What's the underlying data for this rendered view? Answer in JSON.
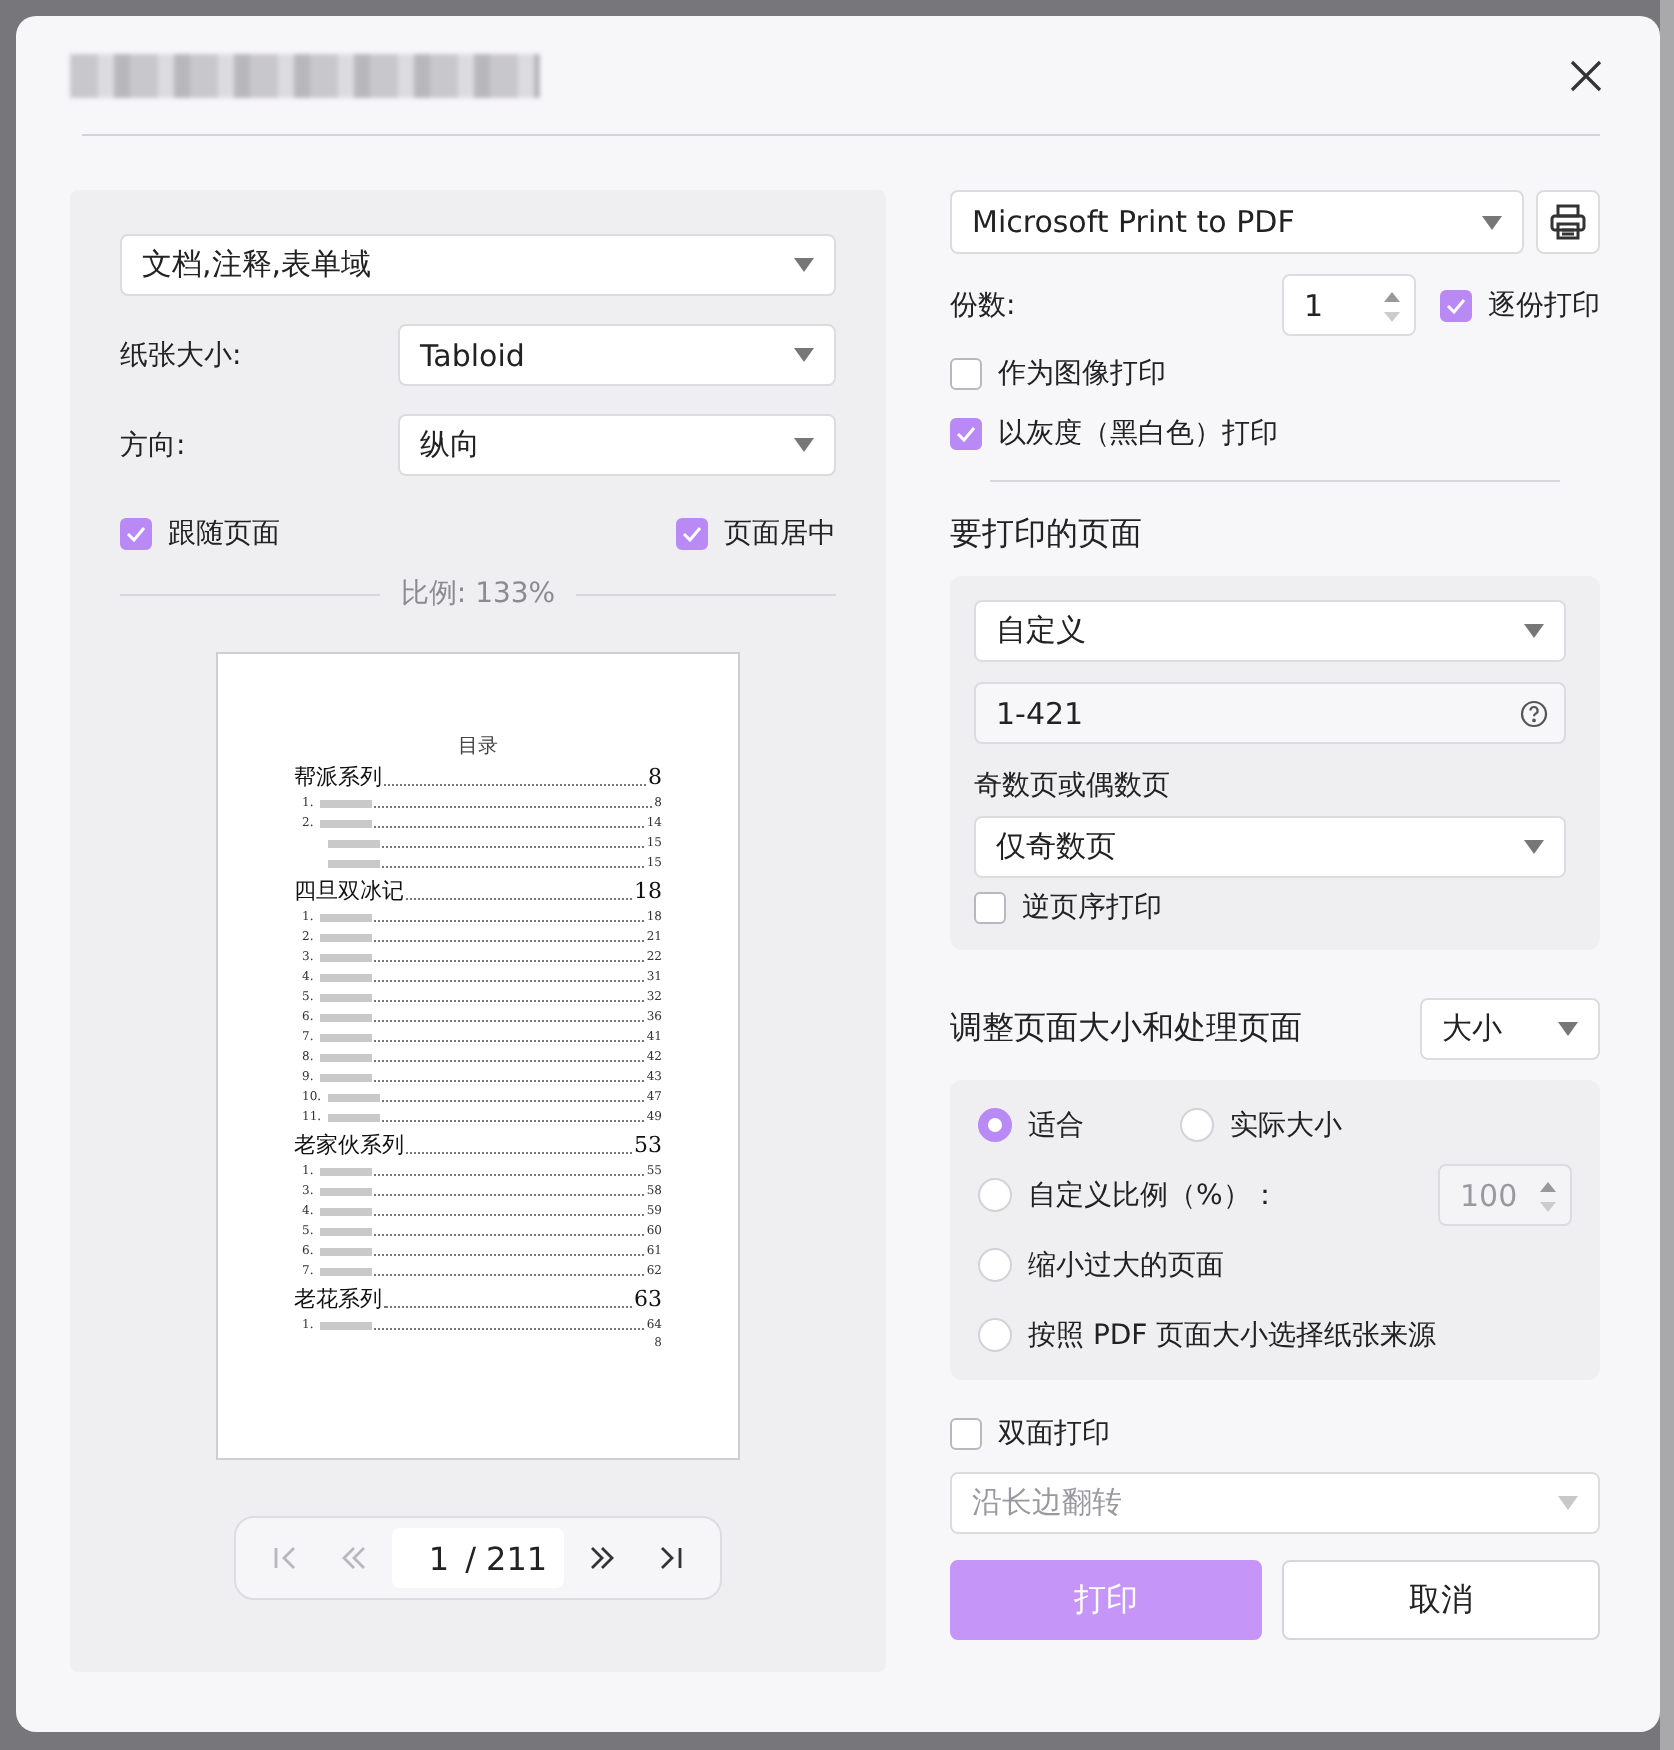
{
  "left": {
    "content": "文档,注释,表单域",
    "paper_size": {
      "label": "纸张大小:",
      "value": "Tabloid"
    },
    "orientation": {
      "label": "方向:",
      "value": "纵向"
    },
    "fit_page": {
      "label": "跟随页面",
      "checked": true
    },
    "center_page": {
      "label": "页面居中",
      "checked": true
    },
    "scale": "比例: 133%",
    "preview": {
      "title": "目录",
      "sections": [
        {
          "heading": "帮派系列",
          "page": "8",
          "entries": [
            {
              "number": "1.",
              "page": "8"
            },
            {
              "number": "2.",
              "page": "14"
            },
            {
              "page": "15"
            },
            {
              "page": "15"
            }
          ]
        },
        {
          "heading": "四旦双冰记",
          "page": "18",
          "entries": [
            {
              "number": "1.",
              "page": "18"
            },
            {
              "number": "2.",
              "page": "21"
            },
            {
              "number": "3.",
              "page": "22"
            },
            {
              "number": "4.",
              "page": "31"
            },
            {
              "number": "5.",
              "page": "32"
            },
            {
              "number": "6.",
              "page": "36"
            },
            {
              "number": "7.",
              "page": "41"
            },
            {
              "number": "8.",
              "page": "42"
            },
            {
              "number": "9.",
              "page": "43"
            },
            {
              "number": "10.",
              "page": "47"
            },
            {
              "number": "11.",
              "page": "49"
            }
          ]
        },
        {
          "heading": "老家伙系列",
          "page": "53",
          "entries": [
            {
              "number": "1.",
              "page": "55"
            },
            {
              "number": "3.",
              "page": "58"
            },
            {
              "number": "4.",
              "page": "59"
            },
            {
              "number": "5.",
              "page": "60"
            },
            {
              "number": "6.",
              "page": "61"
            },
            {
              "number": "7.",
              "page": "62"
            }
          ]
        },
        {
          "heading": "老花系列",
          "page": "63",
          "entries": [
            {
              "number": "1.",
              "page": "64"
            }
          ]
        }
      ],
      "footer_page": "8"
    },
    "pager": {
      "current": "1",
      "total": "/ 211",
      "buttons": [
        {
          "kind": "first",
          "disabled": true
        },
        {
          "kind": "prev",
          "disabled": true
        },
        {
          "kind": "next",
          "disabled": false
        },
        {
          "kind": "last",
          "disabled": false
        }
      ]
    }
  },
  "right": {
    "printer": "Microsoft Print to PDF",
    "copies": {
      "label": "份数:",
      "value": "1"
    },
    "collate": {
      "label": "逐份打印",
      "checked": true
    },
    "as_image": {
      "label": "作为图像打印",
      "checked": false
    },
    "grayscale": {
      "label": "以灰度（黑白色）打印",
      "checked": true
    },
    "pages": {
      "title": "要打印的页面",
      "mode": "自定义",
      "range": "1-421",
      "odd_even_label": "奇数页或偶数页",
      "odd_even": "仅奇数页",
      "reverse": {
        "label": "逆页序打印",
        "checked": false
      }
    },
    "sizing": {
      "title": "调整页面大小和处理页面",
      "mode": "大小",
      "options": [
        {
          "label": "适合",
          "selected": true
        },
        {
          "label": "实际大小",
          "selected": false
        },
        {
          "label": "自定义比例（%）：",
          "selected": false
        },
        {
          "label": "缩小过大的页面",
          "selected": false
        },
        {
          "label": "按照 PDF 页面大小选择纸张来源",
          "selected": false
        }
      ],
      "custom_scale": {
        "value": "100",
        "disabled": true
      }
    },
    "duplex": {
      "label": "双面打印",
      "checked": false
    },
    "flip": {
      "value": "沿长边翻转",
      "disabled": true
    },
    "print_button": "打印",
    "cancel_button": "取消"
  }
}
